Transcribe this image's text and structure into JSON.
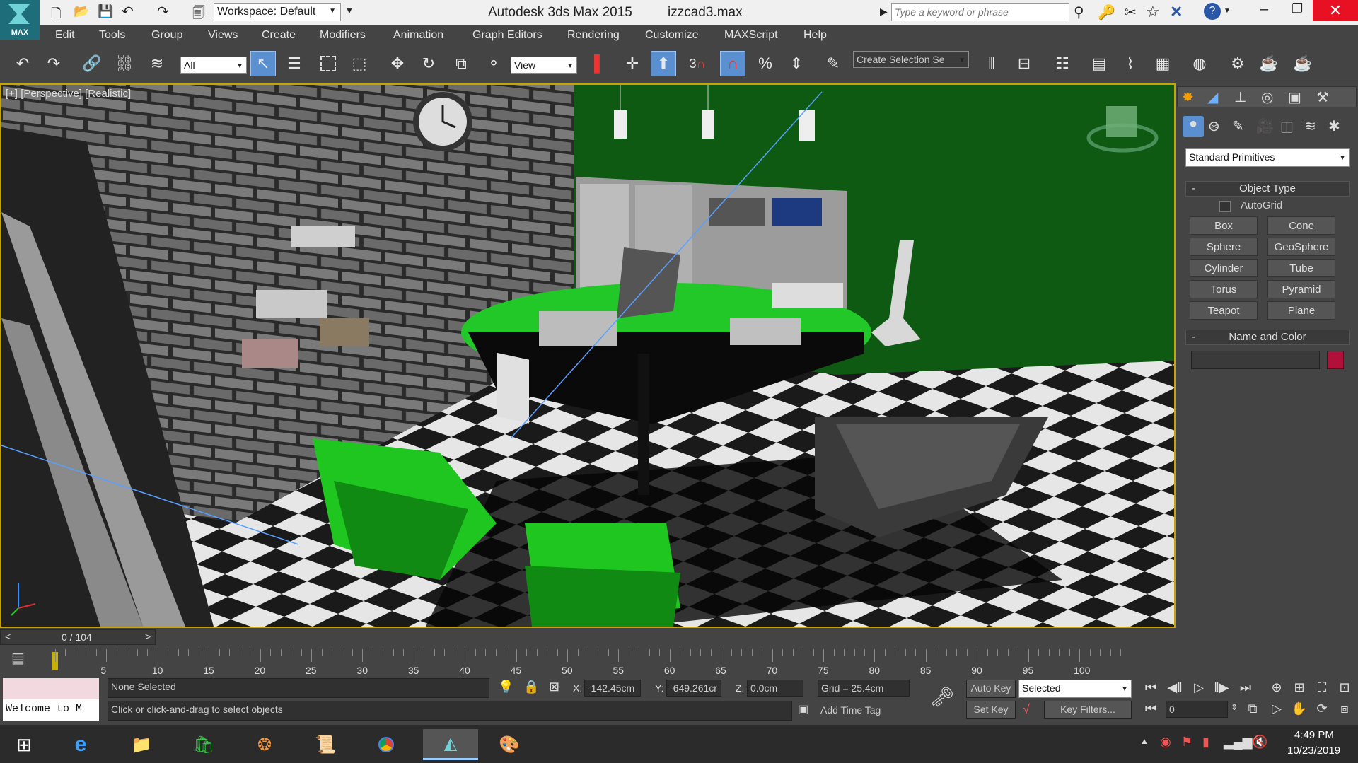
{
  "titlebar": {
    "app_logo": "MAX",
    "workspace": "Workspace: Default",
    "title": "Autodesk 3ds Max  2015",
    "filename": "izzcad3.max",
    "search_placeholder": "Type a keyword or phrase"
  },
  "menu": [
    "Edit",
    "Tools",
    "Group",
    "Views",
    "Create",
    "Modifiers",
    "Animation",
    "Graph Editors",
    "Rendering",
    "Customize",
    "MAXScript",
    "Help"
  ],
  "toolbar": {
    "filter_value": "All",
    "refcoord_value": "View",
    "selection_set_placeholder": "Create Selection Se",
    "snap_label": "3"
  },
  "viewport": {
    "label": "[+] [Perspective] [Realistic]",
    "colors": {
      "floor_light": "#e6e6e6",
      "floor_dark": "#1a1a1a",
      "wall_green": "#0e5a12",
      "desk_green": "#22c828",
      "brick": "#6e6e6e"
    }
  },
  "cmdpanel": {
    "dropdown": "Standard Primitives",
    "object_type_title": "Object Type",
    "autogrid_label": "AutoGrid",
    "buttons": [
      "Box",
      "Cone",
      "Sphere",
      "GeoSphere",
      "Cylinder",
      "Tube",
      "Torus",
      "Pyramid",
      "Teapot",
      "Plane"
    ],
    "name_color_title": "Name and Color",
    "color_swatch": "#b0103a"
  },
  "timeline": {
    "frame_label": "0 / 104",
    "ticks": [
      "5",
      "10",
      "15",
      "20",
      "25",
      "30",
      "35",
      "40",
      "45",
      "50",
      "55",
      "60",
      "65",
      "70",
      "75",
      "80",
      "85",
      "90",
      "95",
      "100"
    ]
  },
  "status": {
    "selection": "None Selected",
    "prompt": "Click or click-and-drag to select objects",
    "listener": "Welcome to M",
    "x_label": "X:",
    "x_value": "-142.45cm",
    "y_label": "Y:",
    "y_value": "-649.261cr",
    "z_label": "Z:",
    "z_value": "0.0cm",
    "grid": "Grid = 25.4cm",
    "add_time_tag": "Add Time Tag",
    "auto_key": "Auto Key",
    "set_key": "Set Key",
    "key_mode": "Selected",
    "key_filters": "Key Filters...",
    "frame_value": "0"
  },
  "taskbar": {
    "time": "4:49 PM",
    "date": "10/23/2019"
  }
}
